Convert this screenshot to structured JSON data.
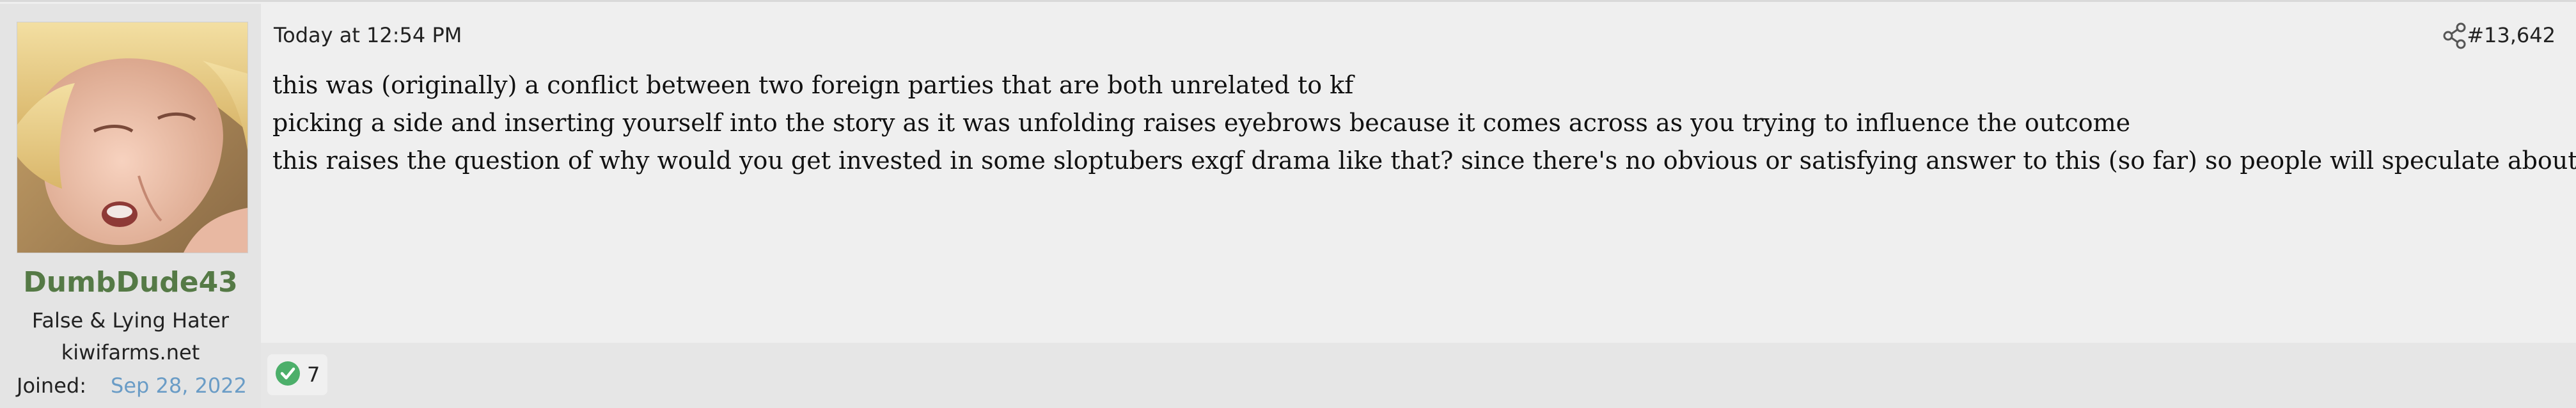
{
  "post": {
    "user": {
      "avatar_icon": "user-avatar",
      "username": "DumbDude43",
      "title": "False & Lying Hater",
      "banner": "kiwifarms.net",
      "joined_label": "Joined:",
      "joined_value": "Sep 28, 2022"
    },
    "header": {
      "date": "Today at 12:54 PM",
      "share_icon": "share-icon",
      "post_number": "#13,642"
    },
    "message": {
      "lines": [
        "this was (originally) a conflict between two foreign parties that are both unrelated to kf",
        "picking a side and inserting yourself into the story as it was unfolding raises eyebrows because it comes across as you trying to influence the outcome",
        "this raises the question of why would you get invested in some sloptubers exgf drama like that? since there's no obvious or satisfying answer to this (so far) so people will speculate about it"
      ]
    },
    "reactions": {
      "icon": "check-circle-icon",
      "count": "7"
    }
  },
  "colors": {
    "username": "#557a46",
    "joined_date": "#6a9cc6",
    "reaction_green": "#4caf6a"
  }
}
